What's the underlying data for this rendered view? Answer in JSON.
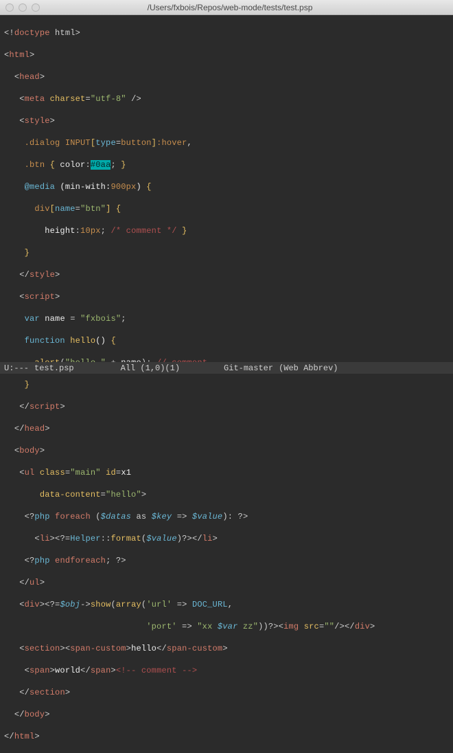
{
  "window": {
    "title": "/Users/fxbois/Repos/web-mode/tests/test.psp"
  },
  "code": {
    "l1": {
      "a": "<!",
      "b": "doctype",
      "c": " html",
      "d": ">"
    },
    "l2": {
      "a": "<",
      "b": "html",
      "c": ">"
    },
    "l3": {
      "a": "<",
      "b": "head",
      "c": ">"
    },
    "l4": {
      "a": "<",
      "b": "meta",
      "sp": " ",
      "attr": "charset",
      "eq": "=",
      "v": "\"utf-8\"",
      "end": " />"
    },
    "l5": {
      "a": "<",
      "b": "style",
      "c": ">"
    },
    "l6": {
      "sel": ".dialog INPUT",
      "br": "[",
      "attr": "type",
      "eq": "=",
      "val": "button",
      "br2": "]",
      "ps": ":hover",
      "cm": ","
    },
    "l7": {
      "sel": ".btn",
      "sp": " ",
      "ob": "{",
      "prop": " color",
      "col": ":",
      "hex": "#0aa",
      "sc": ";",
      "cb": " }"
    },
    "l8": {
      "at": "@media",
      "sp": " ",
      "cond": "(min-with:",
      "v": "900px",
      "cp": ")",
      "ob": " {"
    },
    "l9": {
      "sel": "div",
      "br": "[",
      "attr": "name",
      "eq": "=",
      "val": "\"btn\"",
      "br2": "]",
      "ob": " {"
    },
    "l10": {
      "prop": "height",
      "col": ":",
      "val": "10px",
      "sc": ";",
      "cmt": " /* comment */",
      "cb": " }"
    },
    "l11": {
      "cb": "}"
    },
    "l12": {
      "a": "</",
      "b": "style",
      "c": ">"
    },
    "l13": {
      "a": "<",
      "b": "script",
      "c": ">"
    },
    "l14": {
      "kw": "var",
      "sp": " ",
      "nm": "name",
      "eq": " = ",
      "v": "\"fxbois\"",
      "sc": ";"
    },
    "l15": {
      "kw": "function",
      "sp": " ",
      "fn": "hello",
      "p": "()",
      "ob": " {"
    },
    "l16": {
      "fn": "alert",
      "op": "(",
      "s": "\"hello \"",
      "pl": " + ",
      "v": "name",
      "cp": ");",
      "cmt": " // comment"
    },
    "l17": {
      "cb": "}"
    },
    "l18": {
      "a": "</",
      "b": "script",
      "c": ">"
    },
    "l19": {
      "a": "</",
      "b": "head",
      "c": ">"
    },
    "l20": {
      "a": "<",
      "b": "body",
      "c": ">"
    },
    "l21": {
      "a": "<",
      "b": "ul",
      "sp": " ",
      "a1": "class",
      "eq1": "=",
      "v1": "\"main\"",
      "sp2": " ",
      "a2": "id",
      "eq2": "=",
      "v2": "x1"
    },
    "l22": {
      "a": "data-content",
      "eq": "=",
      "v": "\"hello\"",
      "end": ">"
    },
    "l23": {
      "d1": "<?",
      "php": "php",
      "sp": " ",
      "kw": "foreach",
      "sp2": " ",
      "op": "(",
      "v1": "$datas",
      "as": " as ",
      "v2": "$key",
      "ar": " => ",
      "v3": "$value",
      "cp": ")",
      "col": ":",
      "d2": " ?>"
    },
    "l24": {
      "a": "<",
      "b": "li",
      "c": ">",
      "d1": "<?=",
      "cls": "Helper",
      "op": "::",
      "fn": "format",
      "p1": "(",
      "v": "$value",
      "p2": ")",
      "d2": "?>",
      "e": "</",
      "f": "li",
      "g": ">"
    },
    "l25": {
      "d1": "<?",
      "php": "php",
      "sp": " ",
      "kw": "endforeach",
      "sc": ";",
      "d2": " ?>"
    },
    "l26": {
      "a": "</",
      "b": "ul",
      "c": ">"
    },
    "l27": {
      "a": "<",
      "b": "div",
      "c": ">",
      "d1": "<?=",
      "v": "$obj",
      "ar": "->",
      "fn": "show",
      "p1": "(",
      "fn2": "array",
      "p2": "(",
      "s1": "'url'",
      "a2": " => ",
      "cn": "DOC_URL",
      "cm": ","
    },
    "l28": {
      "s1": "'port'",
      "ar": " => ",
      "s2": "\"xx ",
      "v": "$var",
      "s3": " zz\"",
      "cp": "))",
      "d2": "?>",
      "a": "<",
      "b": "img",
      "sp": " ",
      "at": "src",
      "eq": "=",
      "vv": "\"\"",
      "sl": "/>",
      "e": "</",
      "f": "div",
      "g": ">"
    },
    "l29": {
      "a": "<",
      "b": "section",
      "c": ">",
      "d": "<",
      "e": "span-custom",
      "f": ">",
      "txt": "hello",
      "g": "</",
      "h": "span-custom",
      "i": ">"
    },
    "l30": {
      "a": "<",
      "b": "span",
      "c": ">",
      "txt": "world",
      "d": "</",
      "e": "span",
      "f": ">",
      "cmt": "<!-- comment -->"
    },
    "l31": {
      "a": "</",
      "b": "section",
      "c": ">"
    },
    "l32": {
      "a": "</",
      "b": "body",
      "c": ">"
    },
    "l33": {
      "a": "</",
      "b": "html",
      "c": ">"
    }
  },
  "modeline": {
    "left": "U:---",
    "file": "test.psp",
    "pos": "All (1,0)(1)",
    "vc": "Git-master",
    "mode": "(Web Abbrev)"
  }
}
